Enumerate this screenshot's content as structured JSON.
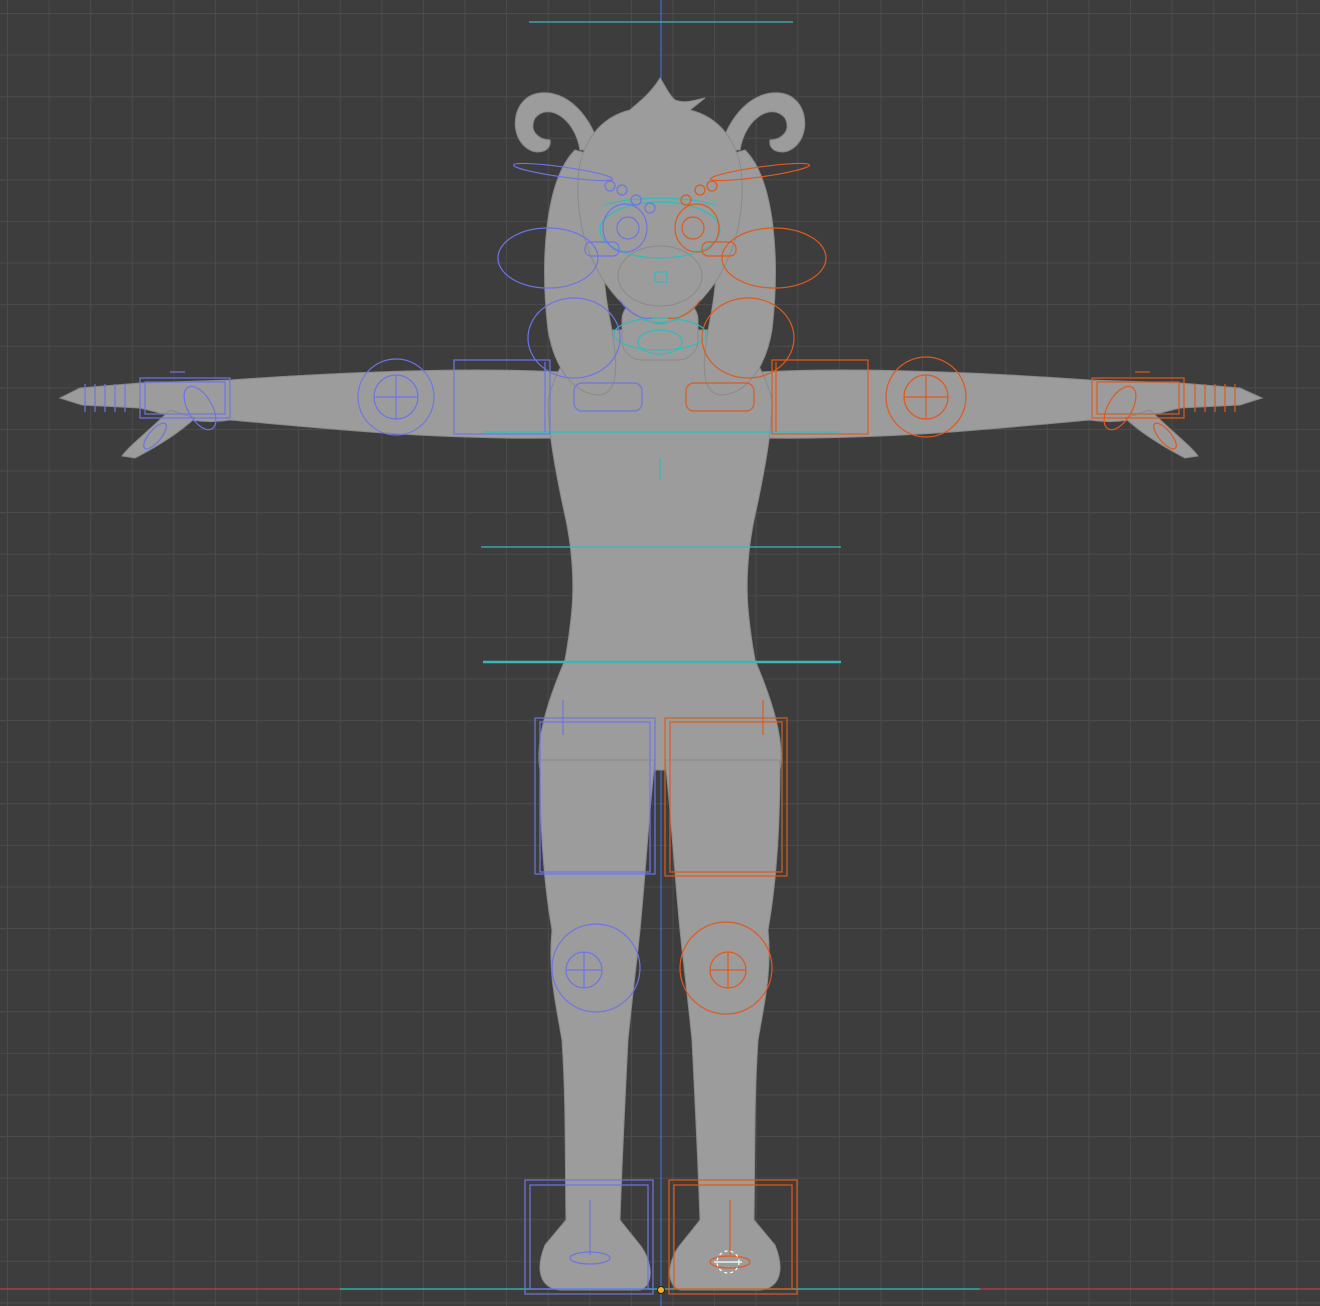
{
  "viewport": {
    "background_color": "#3d3d3d",
    "grid_color": "#4b4b4b",
    "x_axis_color": "#b3444f",
    "z_axis_color": "#3e6ed1"
  },
  "model": {
    "mesh_color": "#9c9c9c",
    "pose": "T-pose"
  },
  "rig": {
    "left_side_color": "#6e74e6",
    "right_side_color": "#e05a1c",
    "center_color": "#2fbcbc"
  },
  "icons": [
    "origin-point-icon",
    "3d-cursor-icon"
  ]
}
